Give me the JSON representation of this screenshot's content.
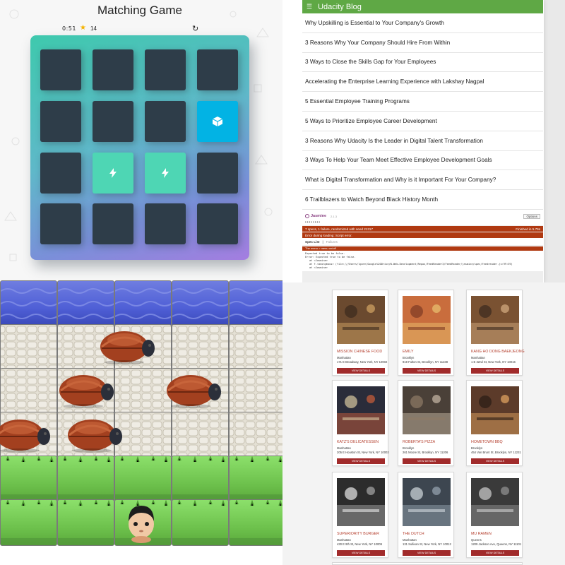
{
  "game": {
    "title": "Matching Game",
    "timer": "0:51",
    "star_icon": "star-icon",
    "moves": "14",
    "restart_icon": "restart-icon",
    "cards": [
      {
        "state": "closed",
        "icon": ""
      },
      {
        "state": "closed",
        "icon": ""
      },
      {
        "state": "closed",
        "icon": ""
      },
      {
        "state": "closed",
        "icon": ""
      },
      {
        "state": "closed",
        "icon": ""
      },
      {
        "state": "closed",
        "icon": ""
      },
      {
        "state": "closed",
        "icon": ""
      },
      {
        "state": "open",
        "icon": "cube-icon"
      },
      {
        "state": "closed",
        "icon": ""
      },
      {
        "state": "match",
        "icon": "bolt-icon"
      },
      {
        "state": "match",
        "icon": "bolt-icon"
      },
      {
        "state": "closed",
        "icon": ""
      },
      {
        "state": "closed",
        "icon": ""
      },
      {
        "state": "closed",
        "icon": ""
      },
      {
        "state": "closed",
        "icon": ""
      },
      {
        "state": "closed",
        "icon": ""
      }
    ],
    "colors": {
      "card_closed": "#2e3d49",
      "card_open": "#02b3e4",
      "card_match": "#4ed6b4"
    }
  },
  "blog": {
    "menu_icon": "menu-icon",
    "title": "Udacity Blog",
    "header_color": "#5fa845",
    "items": [
      "Why Upskilling is Essential to Your Company's Growth",
      "3 Reasons Why Your Company Should Hire From Within",
      "3 Ways to Close the Skills Gap for Your Employees",
      "Accelerating the Enterprise Learning Experience with Lakshay Nagpal",
      "5 Essential Employee Training Programs",
      "5 Ways to Prioritize Employee Career Development",
      "3 Reasons Why Udacity Is the Leader in Digital Talent Transformation",
      "3 Ways To Help Your Team Meet Effective Employee Development Goals",
      "What is Digital Transformation and Why is it Important For Your Company?",
      "6 Trailblazers to Watch Beyond Black History Month"
    ],
    "jasmine": {
      "logo": "Jasmine",
      "version": "2.1.3",
      "options_label": "Options",
      "dots": "••••••••",
      "fail_summary": "7 specs, 1 failure, randomized with seed 21317",
      "finished": "Finished in 5.79s",
      "error": "Error during loading: Script error.",
      "tab_spec_list": "Spec List",
      "tab_failures": "Failures",
      "failing_spec": "The menu > menu on/off",
      "detail_lines": [
        "Expected true to be false.",
        "Error: Expected true to be false.",
        "at <Jasmine>",
        "at f.<anonymous> (file:///Users/lgore/Google%20Drive/W-Web-Development/Repos/FeedReader3/FeedReader/jasmine/spec/feedreader.js:99:39)",
        "at <Jasmine>"
      ],
      "fail_color": "#b03911"
    }
  },
  "frogger": {
    "rows": [
      "water",
      "stone",
      "stone",
      "stone",
      "grass",
      "grass"
    ],
    "enemy_icon": "ladybug-enemy",
    "player_icon": "boy-player"
  },
  "restaurants": {
    "button_label": "VIEW DETAILS",
    "accent": "#a12b2b",
    "items": [
      {
        "name": "MISSION CHINESE FOOD",
        "hood": "Manhattan",
        "addr": "171 E Broadway, New York, NY 10002",
        "img": "restaurant-photo"
      },
      {
        "name": "EMILY",
        "hood": "Brooklyn",
        "addr": "919 Fulton St, Brooklyn, NY 11238",
        "img": "pizza-photo"
      },
      {
        "name": "KANG HO DONG BAEKJEONG",
        "hood": "Manhattan",
        "addr": "1 E 32nd St, New York, NY 10016",
        "img": "restaurant-photo"
      },
      {
        "name": "KATZ'S DELICATESSEN",
        "hood": "Manhattan",
        "addr": "205 E Houston St, New York, NY 10002",
        "img": "storefront-photo"
      },
      {
        "name": "ROBERTA'S PIZZA",
        "hood": "Brooklyn",
        "addr": "261 Moore St, Brooklyn, NY 11206",
        "img": "restaurant-photo"
      },
      {
        "name": "HOMETOWN BBQ",
        "hood": "Brooklyn",
        "addr": "454 Van Brunt St, Brooklyn, NY 11231",
        "img": "restaurant-photo"
      },
      {
        "name": "SUPERIORITY BURGER",
        "hood": "Manhattan",
        "addr": "430 E 9th St, New York, NY 10009",
        "img": "storefront-photo"
      },
      {
        "name": "THE DUTCH",
        "hood": "Manhattan",
        "addr": "131 Sullivan St, New York, NY 10012",
        "img": "storefront-photo"
      },
      {
        "name": "MU RAMEN",
        "hood": "Queens",
        "addr": "1209 Jackson Ave, Queens, NY 11101",
        "img": "restaurant-photo"
      }
    ]
  }
}
